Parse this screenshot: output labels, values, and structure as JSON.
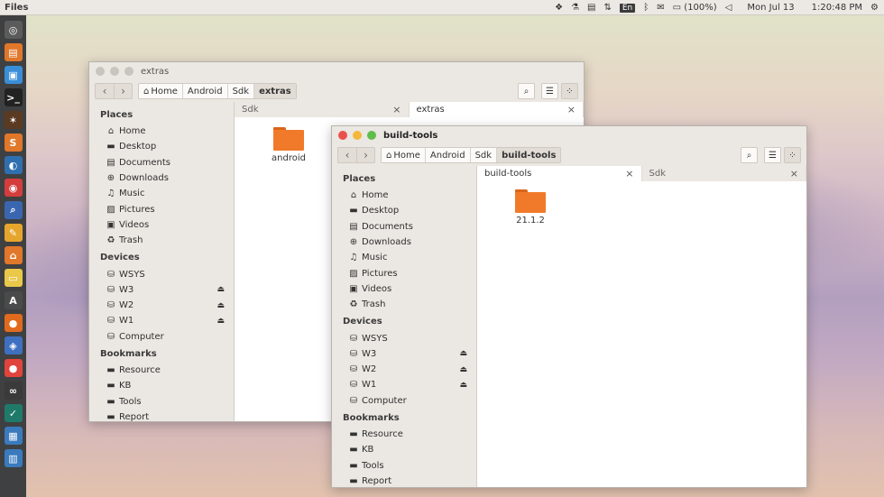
{
  "topbar": {
    "app_name": "Files",
    "language": "En",
    "battery": "(100%)",
    "date": "Mon Jul 13",
    "time": "1:20:48 PM"
  },
  "launcher": {
    "items": [
      {
        "icon": "disc-icon",
        "color": "#5b5b5b",
        "glyph": "◎"
      },
      {
        "icon": "files-icon",
        "color": "#e0772a",
        "glyph": "▤"
      },
      {
        "icon": "window-icon",
        "color": "#3a8ed8",
        "glyph": "▣"
      },
      {
        "icon": "terminal-icon",
        "color": "#222222",
        "glyph": ">_"
      },
      {
        "icon": "star-icon",
        "color": "#5b3a22",
        "glyph": "✶"
      },
      {
        "icon": "sublime-icon",
        "color": "#e0772a",
        "glyph": "S"
      },
      {
        "icon": "globe-icon",
        "color": "#2f6fb0",
        "glyph": "◐"
      },
      {
        "icon": "eye-icon",
        "color": "#d43d3d",
        "glyph": "◉"
      },
      {
        "icon": "search-icon",
        "color": "#3a66b0",
        "glyph": "⌕"
      },
      {
        "icon": "paint-icon",
        "color": "#e6a52d",
        "glyph": "✎"
      },
      {
        "icon": "store-icon",
        "color": "#e0772a",
        "glyph": "⌂"
      },
      {
        "icon": "notes-icon",
        "color": "#e9c84a",
        "glyph": "▭"
      },
      {
        "icon": "software-icon",
        "color": "#4a4a4a",
        "glyph": "A"
      },
      {
        "icon": "firefox-icon",
        "color": "#e06a1e",
        "glyph": "●"
      },
      {
        "icon": "brain-icon",
        "color": "#3f70c0",
        "glyph": "◈"
      },
      {
        "icon": "record-icon",
        "color": "#e0443d",
        "glyph": "●"
      },
      {
        "icon": "link-icon",
        "color": "#3a3a3a",
        "glyph": "∞"
      },
      {
        "icon": "check-icon",
        "color": "#1f7a6a",
        "glyph": "✓"
      },
      {
        "icon": "robot-icon",
        "color": "#3a7abd",
        "glyph": "▦"
      },
      {
        "icon": "printer-icon",
        "color": "#3a7abd",
        "glyph": "▥"
      }
    ]
  },
  "colors": {
    "accent_folder": "#f07a2a",
    "close_button": "#e9524b",
    "minimize_button": "#f3b83b",
    "maximize_button": "#5fbd4a"
  },
  "back_window": {
    "title": "extras",
    "breadcrumbs": [
      "Home",
      "Android",
      "Sdk",
      "extras"
    ],
    "sidebar": {
      "places_header": "Places",
      "places": [
        {
          "label": "Home",
          "icon": "home-icon",
          "glyph": "⌂"
        },
        {
          "label": "Desktop",
          "icon": "desktop-icon",
          "glyph": "▬"
        },
        {
          "label": "Documents",
          "icon": "document-icon",
          "glyph": "▤"
        },
        {
          "label": "Downloads",
          "icon": "download-icon",
          "glyph": "⊕"
        },
        {
          "label": "Music",
          "icon": "music-icon",
          "glyph": "♫"
        },
        {
          "label": "Pictures",
          "icon": "picture-icon",
          "glyph": "▨"
        },
        {
          "label": "Videos",
          "icon": "video-icon",
          "glyph": "▣"
        },
        {
          "label": "Trash",
          "icon": "trash-icon",
          "glyph": "♻"
        }
      ],
      "devices_header": "Devices",
      "devices": [
        {
          "label": "WSYS",
          "eject": false
        },
        {
          "label": "W3",
          "eject": true
        },
        {
          "label": "W2",
          "eject": true
        },
        {
          "label": "W1",
          "eject": true
        },
        {
          "label": "Computer",
          "eject": false
        }
      ],
      "bookmarks_header": "Bookmarks",
      "bookmarks": [
        "Resource",
        "KB",
        "Tools",
        "Report"
      ]
    },
    "tabs": [
      {
        "label": "Sdk",
        "active": false
      },
      {
        "label": "extras",
        "active": true
      }
    ],
    "files": [
      "android"
    ]
  },
  "front_window": {
    "title": "build-tools",
    "breadcrumbs": [
      "Home",
      "Android",
      "Sdk",
      "build-tools"
    ],
    "sidebar": {
      "places_header": "Places",
      "places": [
        {
          "label": "Home",
          "icon": "home-icon",
          "glyph": "⌂"
        },
        {
          "label": "Desktop",
          "icon": "desktop-icon",
          "glyph": "▬"
        },
        {
          "label": "Documents",
          "icon": "document-icon",
          "glyph": "▤"
        },
        {
          "label": "Downloads",
          "icon": "download-icon",
          "glyph": "⊕"
        },
        {
          "label": "Music",
          "icon": "music-icon",
          "glyph": "♫"
        },
        {
          "label": "Pictures",
          "icon": "picture-icon",
          "glyph": "▨"
        },
        {
          "label": "Videos",
          "icon": "video-icon",
          "glyph": "▣"
        },
        {
          "label": "Trash",
          "icon": "trash-icon",
          "glyph": "♻"
        }
      ],
      "devices_header": "Devices",
      "devices": [
        {
          "label": "WSYS",
          "eject": false
        },
        {
          "label": "W3",
          "eject": true
        },
        {
          "label": "W2",
          "eject": true
        },
        {
          "label": "W1",
          "eject": true
        },
        {
          "label": "Computer",
          "eject": false
        }
      ],
      "bookmarks_header": "Bookmarks",
      "bookmarks": [
        "Resource",
        "KB",
        "Tools",
        "Report"
      ]
    },
    "tabs": [
      {
        "label": "build-tools",
        "active": true
      },
      {
        "label": "Sdk",
        "active": false
      }
    ],
    "files": [
      "21.1.2"
    ]
  }
}
